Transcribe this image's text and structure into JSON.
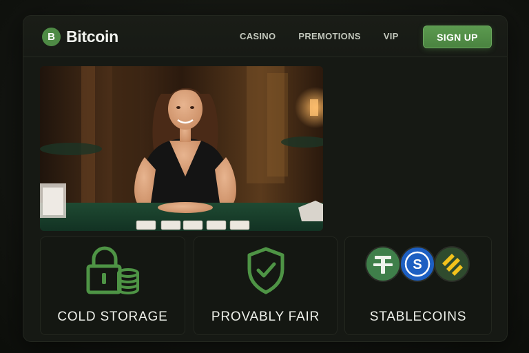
{
  "brand": {
    "logo_letter": "B",
    "name": "Bitcoin"
  },
  "nav": {
    "links": [
      "CASINO",
      "PREMOTIONS",
      "VIP"
    ],
    "cta_label": "SIGN UP"
  },
  "features": [
    {
      "label": "COLD STORAGE",
      "icon": "lock-with-coins-icon"
    },
    {
      "label": "PROVABLY FAIR",
      "icon": "shield-check-icon"
    },
    {
      "label": "STABLECOINS",
      "icon": "stablecoin-logos-icon"
    }
  ],
  "colors": {
    "accent": "#4e8a45",
    "background": "#121410",
    "panel": "#161914"
  }
}
